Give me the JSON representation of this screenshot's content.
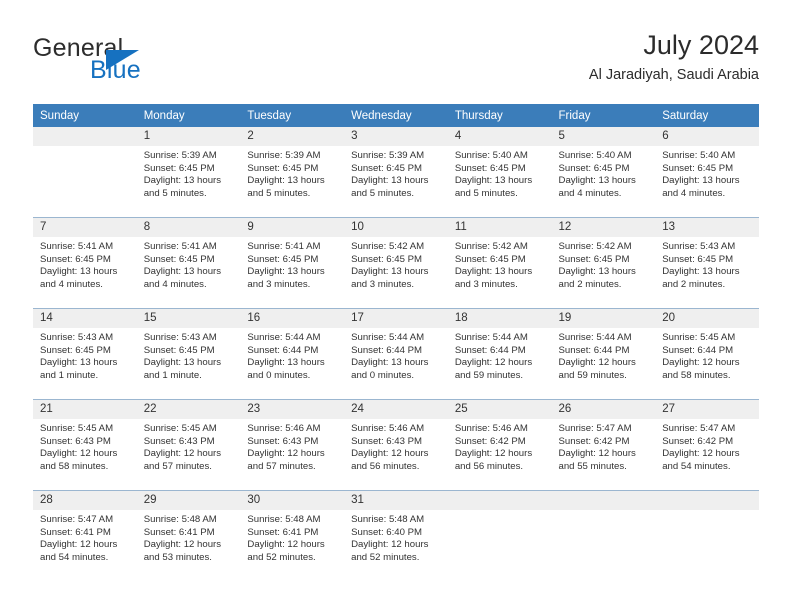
{
  "brand": {
    "name_top": "General",
    "name_bottom": "Blue"
  },
  "header": {
    "title": "July 2024",
    "subtitle": "Al Jaradiyah, Saudi Arabia"
  },
  "colors": {
    "header_row": "#3b7dba",
    "brand_blue": "#1671c0",
    "daynum_band": "#efefef",
    "row_divider": "#9bb6d0"
  },
  "weekday_headers": [
    "Sunday",
    "Monday",
    "Tuesday",
    "Wednesday",
    "Thursday",
    "Friday",
    "Saturday"
  ],
  "weeks": [
    [
      {
        "day": "",
        "empty": true,
        "sunrise": "",
        "sunset": "",
        "daylight_1": "",
        "daylight_2": ""
      },
      {
        "day": "1",
        "sunrise": "Sunrise: 5:39 AM",
        "sunset": "Sunset: 6:45 PM",
        "daylight_1": "Daylight: 13 hours",
        "daylight_2": "and 5 minutes."
      },
      {
        "day": "2",
        "sunrise": "Sunrise: 5:39 AM",
        "sunset": "Sunset: 6:45 PM",
        "daylight_1": "Daylight: 13 hours",
        "daylight_2": "and 5 minutes."
      },
      {
        "day": "3",
        "sunrise": "Sunrise: 5:39 AM",
        "sunset": "Sunset: 6:45 PM",
        "daylight_1": "Daylight: 13 hours",
        "daylight_2": "and 5 minutes."
      },
      {
        "day": "4",
        "sunrise": "Sunrise: 5:40 AM",
        "sunset": "Sunset: 6:45 PM",
        "daylight_1": "Daylight: 13 hours",
        "daylight_2": "and 5 minutes."
      },
      {
        "day": "5",
        "sunrise": "Sunrise: 5:40 AM",
        "sunset": "Sunset: 6:45 PM",
        "daylight_1": "Daylight: 13 hours",
        "daylight_2": "and 4 minutes."
      },
      {
        "day": "6",
        "sunrise": "Sunrise: 5:40 AM",
        "sunset": "Sunset: 6:45 PM",
        "daylight_1": "Daylight: 13 hours",
        "daylight_2": "and 4 minutes."
      }
    ],
    [
      {
        "day": "7",
        "sunrise": "Sunrise: 5:41 AM",
        "sunset": "Sunset: 6:45 PM",
        "daylight_1": "Daylight: 13 hours",
        "daylight_2": "and 4 minutes."
      },
      {
        "day": "8",
        "sunrise": "Sunrise: 5:41 AM",
        "sunset": "Sunset: 6:45 PM",
        "daylight_1": "Daylight: 13 hours",
        "daylight_2": "and 4 minutes."
      },
      {
        "day": "9",
        "sunrise": "Sunrise: 5:41 AM",
        "sunset": "Sunset: 6:45 PM",
        "daylight_1": "Daylight: 13 hours",
        "daylight_2": "and 3 minutes."
      },
      {
        "day": "10",
        "sunrise": "Sunrise: 5:42 AM",
        "sunset": "Sunset: 6:45 PM",
        "daylight_1": "Daylight: 13 hours",
        "daylight_2": "and 3 minutes."
      },
      {
        "day": "11",
        "sunrise": "Sunrise: 5:42 AM",
        "sunset": "Sunset: 6:45 PM",
        "daylight_1": "Daylight: 13 hours",
        "daylight_2": "and 3 minutes."
      },
      {
        "day": "12",
        "sunrise": "Sunrise: 5:42 AM",
        "sunset": "Sunset: 6:45 PM",
        "daylight_1": "Daylight: 13 hours",
        "daylight_2": "and 2 minutes."
      },
      {
        "day": "13",
        "sunrise": "Sunrise: 5:43 AM",
        "sunset": "Sunset: 6:45 PM",
        "daylight_1": "Daylight: 13 hours",
        "daylight_2": "and 2 minutes."
      }
    ],
    [
      {
        "day": "14",
        "sunrise": "Sunrise: 5:43 AM",
        "sunset": "Sunset: 6:45 PM",
        "daylight_1": "Daylight: 13 hours",
        "daylight_2": "and 1 minute."
      },
      {
        "day": "15",
        "sunrise": "Sunrise: 5:43 AM",
        "sunset": "Sunset: 6:45 PM",
        "daylight_1": "Daylight: 13 hours",
        "daylight_2": "and 1 minute."
      },
      {
        "day": "16",
        "sunrise": "Sunrise: 5:44 AM",
        "sunset": "Sunset: 6:44 PM",
        "daylight_1": "Daylight: 13 hours",
        "daylight_2": "and 0 minutes."
      },
      {
        "day": "17",
        "sunrise": "Sunrise: 5:44 AM",
        "sunset": "Sunset: 6:44 PM",
        "daylight_1": "Daylight: 13 hours",
        "daylight_2": "and 0 minutes."
      },
      {
        "day": "18",
        "sunrise": "Sunrise: 5:44 AM",
        "sunset": "Sunset: 6:44 PM",
        "daylight_1": "Daylight: 12 hours",
        "daylight_2": "and 59 minutes."
      },
      {
        "day": "19",
        "sunrise": "Sunrise: 5:44 AM",
        "sunset": "Sunset: 6:44 PM",
        "daylight_1": "Daylight: 12 hours",
        "daylight_2": "and 59 minutes."
      },
      {
        "day": "20",
        "sunrise": "Sunrise: 5:45 AM",
        "sunset": "Sunset: 6:44 PM",
        "daylight_1": "Daylight: 12 hours",
        "daylight_2": "and 58 minutes."
      }
    ],
    [
      {
        "day": "21",
        "sunrise": "Sunrise: 5:45 AM",
        "sunset": "Sunset: 6:43 PM",
        "daylight_1": "Daylight: 12 hours",
        "daylight_2": "and 58 minutes."
      },
      {
        "day": "22",
        "sunrise": "Sunrise: 5:45 AM",
        "sunset": "Sunset: 6:43 PM",
        "daylight_1": "Daylight: 12 hours",
        "daylight_2": "and 57 minutes."
      },
      {
        "day": "23",
        "sunrise": "Sunrise: 5:46 AM",
        "sunset": "Sunset: 6:43 PM",
        "daylight_1": "Daylight: 12 hours",
        "daylight_2": "and 57 minutes."
      },
      {
        "day": "24",
        "sunrise": "Sunrise: 5:46 AM",
        "sunset": "Sunset: 6:43 PM",
        "daylight_1": "Daylight: 12 hours",
        "daylight_2": "and 56 minutes."
      },
      {
        "day": "25",
        "sunrise": "Sunrise: 5:46 AM",
        "sunset": "Sunset: 6:42 PM",
        "daylight_1": "Daylight: 12 hours",
        "daylight_2": "and 56 minutes."
      },
      {
        "day": "26",
        "sunrise": "Sunrise: 5:47 AM",
        "sunset": "Sunset: 6:42 PM",
        "daylight_1": "Daylight: 12 hours",
        "daylight_2": "and 55 minutes."
      },
      {
        "day": "27",
        "sunrise": "Sunrise: 5:47 AM",
        "sunset": "Sunset: 6:42 PM",
        "daylight_1": "Daylight: 12 hours",
        "daylight_2": "and 54 minutes."
      }
    ],
    [
      {
        "day": "28",
        "sunrise": "Sunrise: 5:47 AM",
        "sunset": "Sunset: 6:41 PM",
        "daylight_1": "Daylight: 12 hours",
        "daylight_2": "and 54 minutes."
      },
      {
        "day": "29",
        "sunrise": "Sunrise: 5:48 AM",
        "sunset": "Sunset: 6:41 PM",
        "daylight_1": "Daylight: 12 hours",
        "daylight_2": "and 53 minutes."
      },
      {
        "day": "30",
        "sunrise": "Sunrise: 5:48 AM",
        "sunset": "Sunset: 6:41 PM",
        "daylight_1": "Daylight: 12 hours",
        "daylight_2": "and 52 minutes."
      },
      {
        "day": "31",
        "sunrise": "Sunrise: 5:48 AM",
        "sunset": "Sunset: 6:40 PM",
        "daylight_1": "Daylight: 12 hours",
        "daylight_2": "and 52 minutes."
      },
      {
        "day": "",
        "empty": true,
        "sunrise": "",
        "sunset": "",
        "daylight_1": "",
        "daylight_2": ""
      },
      {
        "day": "",
        "empty": true,
        "sunrise": "",
        "sunset": "",
        "daylight_1": "",
        "daylight_2": ""
      },
      {
        "day": "",
        "empty": true,
        "sunrise": "",
        "sunset": "",
        "daylight_1": "",
        "daylight_2": ""
      }
    ]
  ]
}
